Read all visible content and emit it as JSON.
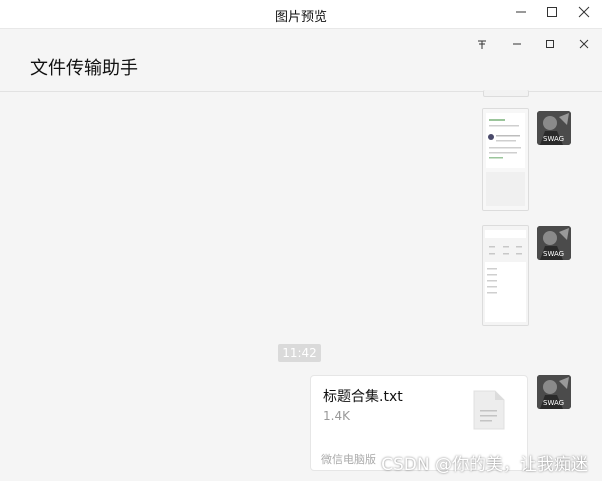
{
  "window": {
    "title": "图片预览",
    "controls": {
      "minimize_icon": "minimize-icon",
      "maximize_icon": "maximize-icon",
      "close_icon": "close-icon"
    }
  },
  "chat": {
    "title": "文件传输助手",
    "controls": {
      "pin_icon": "pin-icon",
      "minimize_icon": "minimize-icon",
      "maximize_icon": "maximize-icon",
      "close_icon": "close-icon"
    }
  },
  "avatar": {
    "label": "SWAG"
  },
  "messages": {
    "timestamp": "11:42",
    "file": {
      "name": "标题合集.txt",
      "size": "1.4K",
      "source": "微信电脑版",
      "icon": "text-file-icon"
    }
  },
  "watermark": "CSDN @你的美，让我痴迷",
  "colors": {
    "background": "#f5f5f5",
    "card": "#ffffff",
    "time_pill": "#dadada"
  }
}
